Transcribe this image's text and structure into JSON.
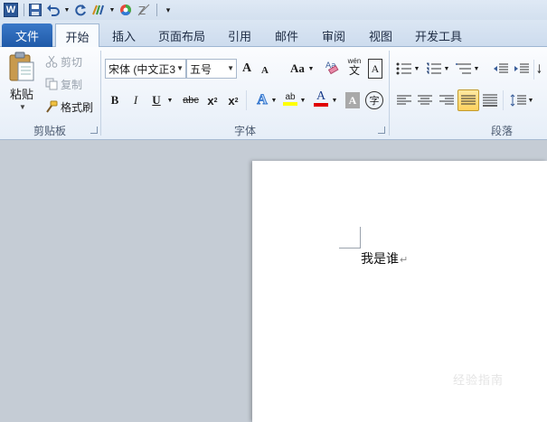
{
  "app": {
    "logo_letter": "W",
    "quick_access": [
      "save-icon",
      "undo-icon",
      "redo-icon",
      "format-icon",
      "color-icon",
      "clear-icon",
      "customize-icon"
    ]
  },
  "tabs": [
    {
      "label": "文件"
    },
    {
      "label": "开始"
    },
    {
      "label": "插入"
    },
    {
      "label": "页面布局"
    },
    {
      "label": "引用"
    },
    {
      "label": "邮件"
    },
    {
      "label": "审阅"
    },
    {
      "label": "视图"
    },
    {
      "label": "开发工具"
    }
  ],
  "clipboard": {
    "paste_label": "粘贴",
    "cut_label": "剪切",
    "copy_label": "复制",
    "format_painter_label": "格式刷",
    "group_label": "剪贴板"
  },
  "font": {
    "font_name": "宋体 (中文正3",
    "font_size": "五号",
    "grow_font": "A",
    "shrink_font": "A",
    "change_case": "Aa",
    "bold": "B",
    "italic": "I",
    "underline": "U",
    "strikethrough": "abc",
    "subscript": "x",
    "superscript": "x",
    "subscript_mark": "2",
    "superscript_mark": "2",
    "font_color_letter": "A",
    "char_shading_letter": "A",
    "enclose_char": "字",
    "phonetic_label": "wén",
    "phonetic_char": "文",
    "char_border_letter": "A",
    "text_effect_letter": "A",
    "highlight_letters": "ab",
    "clear_format_letters": "A",
    "group_label": "字体"
  },
  "paragraph": {
    "group_label": "段落"
  },
  "document": {
    "text": "我是谁",
    "paragraph_mark": "↵",
    "watermark": "经验指南"
  },
  "colors": {
    "file_tab": "#2b6cc0",
    "highlight_yellow": "#ffff00",
    "font_color_red": "#e00000",
    "active_align": "#ffd96b"
  }
}
